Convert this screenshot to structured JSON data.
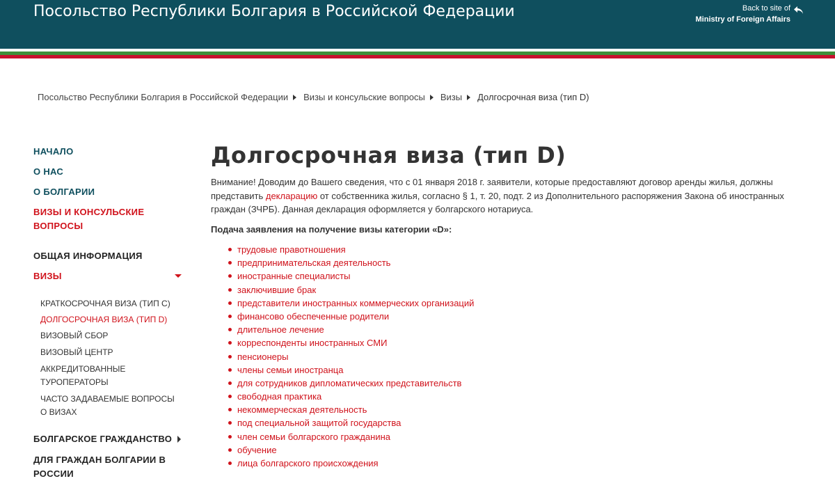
{
  "header": {
    "site_title": "Посольство Республики Болгария в Российской Федерации",
    "back_line1": "Back to site of",
    "back_line2": "Ministry of Foreign Affairs",
    "back_icon": "back-arrow-icon"
  },
  "colors": {
    "header_bg": "#0f4f5e",
    "accent_red": "#d0121b",
    "flag_green": "#3f8f3a",
    "flag_red": "#c8102e"
  },
  "breadcrumb": [
    "Посольство Республики Болгария в Российской Федерации",
    "Визы и консульские вопросы",
    "Визы",
    "Долгосрочная виза (тип D)"
  ],
  "sidebar": {
    "items": [
      {
        "label": "НАЧАЛО"
      },
      {
        "label": "О НАС"
      },
      {
        "label": "О БОЛГАРИИ"
      },
      {
        "label": "ВИЗЫ И КОНСУЛЬСКИЕ ВОПРОСЫ"
      },
      {
        "label": "ОБЩАЯ ИНФОРМАЦИЯ"
      },
      {
        "label": "ВИЗЫ"
      },
      {
        "label": "БОЛГАРСКОЕ ГРАЖДАНСТВО"
      },
      {
        "label": "ДЛЯ ГРАЖДАН БОЛГАРИИ В РОССИИ"
      }
    ],
    "visa_sub": [
      {
        "label": "КРАТКОСРОЧНАЯ ВИЗА (ТИП С)"
      },
      {
        "label": "ДОЛГОСРОЧНАЯ ВИЗА (ТИП D)"
      },
      {
        "label": "ВИЗОВЫЙ СБОР"
      },
      {
        "label": "ВИЗОВЫЙ ЦЕНТР"
      },
      {
        "label": "АККРЕДИТОВАННЫЕ ТУРОПЕРАТОРЫ"
      },
      {
        "label": "ЧАСТО ЗАДАВАЕМЫЕ ВОПРОСЫ О ВИЗАХ"
      }
    ]
  },
  "main": {
    "title": "Долгосрочная виза (тип D)",
    "intro_before": "Внимание! Доводим до Вашего сведения, что с 01 января 2018 г. заявители, которые предоставляют договор аренды жилья, должны представить ",
    "intro_link": "декларацию",
    "intro_after": " от собственника жилья, согласно § 1, т. 20, подт. 2 из Дополнительного распоряжения Закона об иностранных граждан (ЗЧРБ). Данная декларация оформляется у болгарского нотариуса.",
    "list_heading": "Подача заявления на получение визы категории «D»:",
    "categories": [
      "трудовые правотношения",
      "предпринимательская деятельность",
      "иностранные специалисты",
      "заключившие брак",
      "представители иностранных коммерческих организаций",
      "финансово обеспеченные родители",
      "длительное лечение",
      "корреспонденты иностранных СМИ",
      "пенсионеры",
      "члены семьи иностранца",
      "для сотрудников дипломатических представительств",
      "свободная практика",
      "некоммерческая деятельность",
      "под специальной защитой государства",
      "член семьи болгарского гражданина",
      "обучение",
      "лица болгарского происхождения"
    ]
  }
}
